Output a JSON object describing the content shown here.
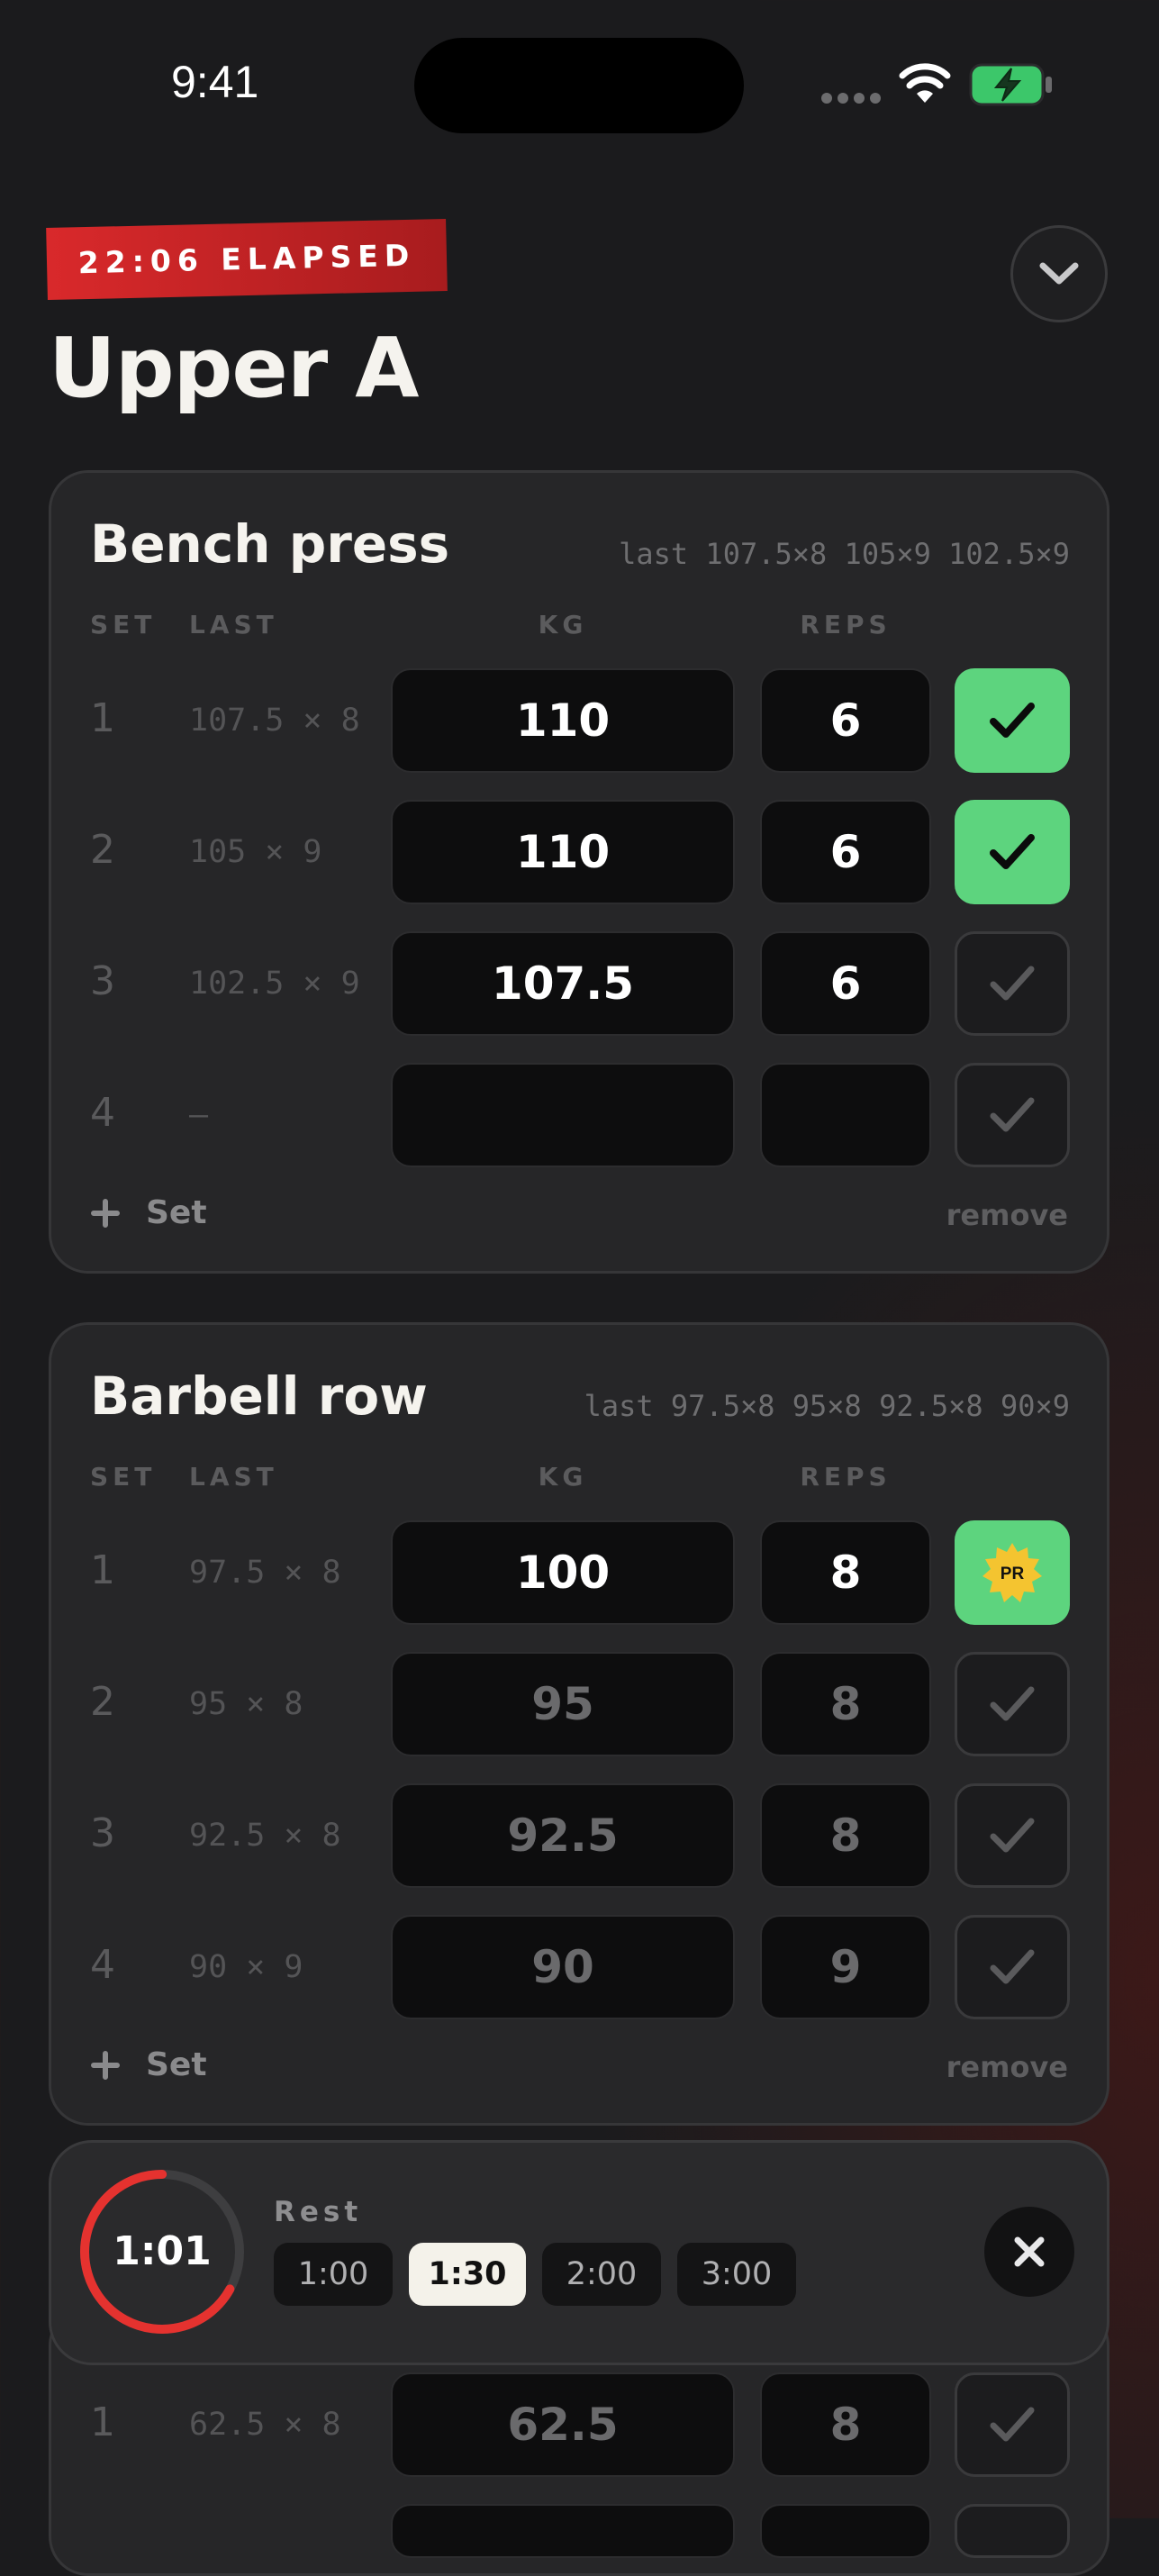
{
  "status_bar": {
    "time": "9:41"
  },
  "header": {
    "elapsed_badge": "22:06 ELAPSED",
    "workout_title": "Upper A"
  },
  "column_headers": {
    "set": "SET",
    "last": "LAST",
    "kg": "KG",
    "reps": "REPS"
  },
  "exercises": [
    {
      "name": "Bench press",
      "history": "last 107.5×8 105×9 102.5×9",
      "sets": [
        {
          "set": "1",
          "last": "107.5 × 8",
          "kg": "110",
          "reps": "6",
          "state": "done"
        },
        {
          "set": "2",
          "last": "105 × 9",
          "kg": "110",
          "reps": "6",
          "state": "done"
        },
        {
          "set": "3",
          "last": "102.5 × 9",
          "kg": "107.5",
          "reps": "6",
          "state": "pending"
        },
        {
          "set": "4",
          "last": "—",
          "kg": "",
          "reps": "",
          "state": "pending"
        }
      ],
      "add_set_label": "Set",
      "remove_label": "remove"
    },
    {
      "name": "Barbell row",
      "history": "last 97.5×8 95×8 92.5×8 90×9",
      "sets": [
        {
          "set": "1",
          "last": "97.5 × 8",
          "kg": "100",
          "reps": "8",
          "state": "pr",
          "badge": "PR"
        },
        {
          "set": "2",
          "last": "95 × 8",
          "kg": "95",
          "reps": "8",
          "state": "pending"
        },
        {
          "set": "3",
          "last": "92.5 × 8",
          "kg": "92.5",
          "reps": "8",
          "state": "pending"
        },
        {
          "set": "4",
          "last": "90 × 9",
          "kg": "90",
          "reps": "9",
          "state": "pending"
        }
      ],
      "add_set_label": "Set",
      "remove_label": "remove"
    }
  ],
  "rest_timer": {
    "countdown": "1:01",
    "progress": 0.67,
    "label": "Rest",
    "presets": [
      "1:00",
      "1:30",
      "2:00",
      "3:00"
    ],
    "selected_preset": "1:30"
  },
  "next_exercise_partial": {
    "set": "1",
    "last": "62.5 × 8",
    "kg": "62.5",
    "reps": "8"
  },
  "colors": {
    "accent_red": "#d9292b",
    "done_green": "#5dd47e",
    "pr_gold": "#f4c430"
  }
}
